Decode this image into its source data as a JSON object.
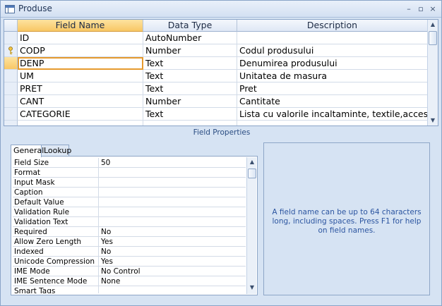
{
  "window": {
    "title": "Produse",
    "minimize_glyph": "–",
    "restore_glyph": "▫",
    "close_glyph": "×"
  },
  "grid": {
    "headers": [
      "Field Name",
      "Data Type",
      "Description"
    ],
    "rows": [
      {
        "name": "ID",
        "type": "AutoNumber",
        "desc": "",
        "key": false
      },
      {
        "name": "CODP",
        "type": "Number",
        "desc": "Codul produsului",
        "key": true
      },
      {
        "name": "DENP",
        "type": "Text",
        "desc": "Denumirea produsului",
        "key": false
      },
      {
        "name": "UM",
        "type": "Text",
        "desc": "Unitatea de masura",
        "key": false
      },
      {
        "name": "PRET",
        "type": "Text",
        "desc": "Pret",
        "key": false
      },
      {
        "name": "CANT",
        "type": "Number",
        "desc": "Cantitate",
        "key": false
      },
      {
        "name": "CATEGORIE",
        "type": "Text",
        "desc": "Lista cu valorile incaltaminte, textile,accesorii",
        "key": false
      },
      {
        "name": "",
        "type": "",
        "desc": "",
        "key": false
      }
    ],
    "selected_row": 2
  },
  "field_properties_label": "Field Properties",
  "tabs": [
    "General",
    "Lookup"
  ],
  "active_tab": "General",
  "properties": [
    {
      "name": "Field Size",
      "value": "50"
    },
    {
      "name": "Format",
      "value": ""
    },
    {
      "name": "Input Mask",
      "value": ""
    },
    {
      "name": "Caption",
      "value": ""
    },
    {
      "name": "Default Value",
      "value": ""
    },
    {
      "name": "Validation Rule",
      "value": ""
    },
    {
      "name": "Validation Text",
      "value": ""
    },
    {
      "name": "Required",
      "value": "No"
    },
    {
      "name": "Allow Zero Length",
      "value": "Yes"
    },
    {
      "name": "Indexed",
      "value": "No"
    },
    {
      "name": "Unicode Compression",
      "value": "Yes"
    },
    {
      "name": "IME Mode",
      "value": "No Control"
    },
    {
      "name": "IME Sentence Mode",
      "value": "None"
    },
    {
      "name": "Smart Tags",
      "value": ""
    }
  ],
  "help_text": "A field name can be up to 64 characters long, including spaces.  Press F1 for help on field names.",
  "colors": {
    "accent_selected": "#f8c765",
    "help_text": "#2c55a0",
    "frame": "#d6e3f3"
  }
}
